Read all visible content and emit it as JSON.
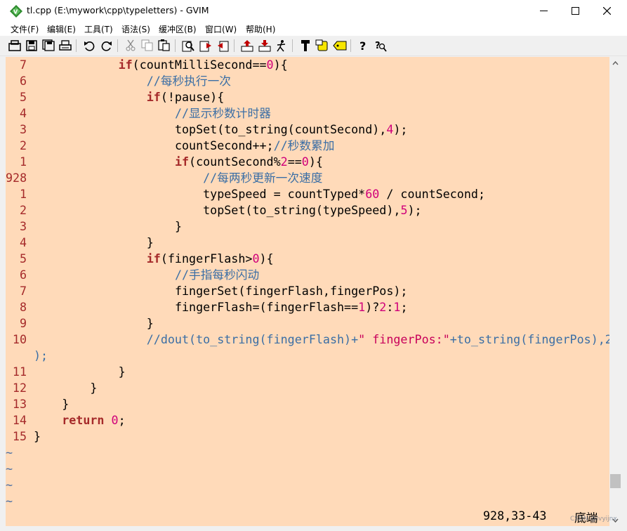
{
  "window": {
    "title": "tl.cpp (E:\\mywork\\cpp\\typeletters) - GVIM",
    "minimize_icon": "minimize-icon",
    "maximize_icon": "maximize-icon",
    "close_icon": "close-icon"
  },
  "menu": {
    "items": [
      {
        "label": "文件(F)"
      },
      {
        "label": "编辑(E)"
      },
      {
        "label": "工具(T)"
      },
      {
        "label": "语法(S)"
      },
      {
        "label": "缓冲区(B)"
      },
      {
        "label": "窗口(W)"
      },
      {
        "label": "帮助(H)"
      }
    ]
  },
  "toolbar": {
    "icons": [
      "open-icon",
      "save-icon",
      "save-all-icon",
      "print-icon",
      "undo-icon",
      "redo-icon",
      "cut-icon",
      "copy-icon",
      "paste-icon",
      "find-replace-icon",
      "find-next-icon",
      "find-prev-icon",
      "load-session-icon",
      "save-session-icon",
      "run-script-icon",
      "make-icon",
      "shell-icon",
      "tag-jump-icon",
      "help-icon",
      "find-help-icon"
    ]
  },
  "editor": {
    "background": "#ffdab9",
    "lines": [
      {
        "n": "7",
        "indent": "            ",
        "segs": [
          [
            "kw",
            "if"
          ],
          [
            "t",
            "(countMilliSecond=="
          ],
          [
            "num",
            "0"
          ],
          [
            "t",
            "){"
          ]
        ]
      },
      {
        "n": "6",
        "indent": "                ",
        "segs": [
          [
            "cm",
            "//每秒执行一次"
          ]
        ]
      },
      {
        "n": "5",
        "indent": "                ",
        "segs": [
          [
            "kw",
            "if"
          ],
          [
            "t",
            "(!pause){"
          ]
        ]
      },
      {
        "n": "4",
        "indent": "                    ",
        "segs": [
          [
            "cm",
            "//显示秒数计时器"
          ]
        ]
      },
      {
        "n": "3",
        "indent": "                    ",
        "segs": [
          [
            "t",
            "topSet(to_string(countSecond),"
          ],
          [
            "num",
            "4"
          ],
          [
            "t",
            ");"
          ]
        ]
      },
      {
        "n": "2",
        "indent": "                    ",
        "segs": [
          [
            "t",
            "countSecond++;"
          ],
          [
            "cm",
            "//秒数累加"
          ]
        ]
      },
      {
        "n": "1",
        "indent": "                    ",
        "segs": [
          [
            "kw",
            "if"
          ],
          [
            "t",
            "(countSecond%"
          ],
          [
            "num",
            "2"
          ],
          [
            "t",
            "=="
          ],
          [
            "num",
            "0"
          ],
          [
            "t",
            "){"
          ]
        ]
      },
      {
        "n": "928",
        "indent": "                        ",
        "segs": [
          [
            "cm",
            "//每两秒更新一次速度"
          ]
        ]
      },
      {
        "n": "1",
        "indent": "                        ",
        "segs": [
          [
            "t",
            "typeSpeed = countTyped*"
          ],
          [
            "num",
            "60"
          ],
          [
            "t",
            " / countSecond;"
          ]
        ]
      },
      {
        "n": "2",
        "indent": "                        ",
        "segs": [
          [
            "t",
            "topSet(to_string(typeSpeed),"
          ],
          [
            "num",
            "5"
          ],
          [
            "t",
            ");"
          ]
        ]
      },
      {
        "n": "3",
        "indent": "                    ",
        "segs": [
          [
            "t",
            "}"
          ]
        ]
      },
      {
        "n": "4",
        "indent": "                ",
        "segs": [
          [
            "t",
            "}"
          ]
        ]
      },
      {
        "n": "5",
        "indent": "                ",
        "segs": [
          [
            "kw",
            "if"
          ],
          [
            "t",
            "(fingerFlash>"
          ],
          [
            "num",
            "0"
          ],
          [
            "t",
            "){"
          ]
        ]
      },
      {
        "n": "6",
        "indent": "                    ",
        "segs": [
          [
            "cm",
            "//手指每秒闪动"
          ]
        ]
      },
      {
        "n": "7",
        "indent": "                    ",
        "segs": [
          [
            "t",
            "fingerSet(fingerFlash,fingerPos);"
          ]
        ]
      },
      {
        "n": "8",
        "indent": "                    ",
        "segs": [
          [
            "t",
            "fingerFlash=(fingerFlash=="
          ],
          [
            "num",
            "1"
          ],
          [
            "t",
            ")?"
          ],
          [
            "num",
            "2"
          ],
          [
            "t",
            ":"
          ],
          [
            "num",
            "1"
          ],
          [
            "t",
            ";"
          ]
        ]
      },
      {
        "n": "9",
        "indent": "                ",
        "segs": [
          [
            "t",
            "}"
          ]
        ]
      },
      {
        "n": "10",
        "indent": "                ",
        "segs": [
          [
            "cm",
            "//dout(to_string(fingerFlash)+"
          ],
          [
            "str",
            "\" fingerPos:\""
          ],
          [
            "cm",
            "+to_string(fingerPos),2"
          ]
        ]
      },
      {
        "n": "",
        "indent": "",
        "segs": [
          [
            "cm",
            ");"
          ]
        ]
      },
      {
        "n": "11",
        "indent": "            ",
        "segs": [
          [
            "t",
            "}"
          ]
        ]
      },
      {
        "n": "12",
        "indent": "        ",
        "segs": [
          [
            "t",
            "}"
          ]
        ]
      },
      {
        "n": "13",
        "indent": "    ",
        "segs": [
          [
            "t",
            "}"
          ]
        ]
      },
      {
        "n": "14",
        "indent": "    ",
        "segs": [
          [
            "kw",
            "return"
          ],
          [
            "t",
            " "
          ],
          [
            "num",
            "0"
          ],
          [
            "t",
            ";"
          ]
        ]
      },
      {
        "n": "15",
        "indent": "",
        "segs": [
          [
            "t",
            "}"
          ]
        ]
      }
    ],
    "tildes": [
      "~",
      "~",
      "~",
      "~"
    ]
  },
  "status": {
    "ruler": "928,33-43",
    "position": "底端"
  },
  "watermark": "CSDN @lvyijnx"
}
